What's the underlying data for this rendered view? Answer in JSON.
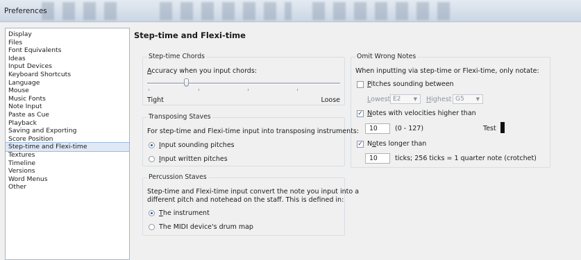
{
  "window": {
    "title": "Preferences"
  },
  "sidebar": {
    "items": [
      "Display",
      "Files",
      "Font Equivalents",
      "Ideas",
      "Input Devices",
      "Keyboard Shortcuts",
      "Language",
      "Mouse",
      "Music Fonts",
      "Note Input",
      "Paste as Cue",
      "Playback",
      "Saving and Exporting",
      "Score Position",
      "Step-time and Flexi-time",
      "Textures",
      "Timeline",
      "Versions",
      "Word Menus",
      "Other"
    ],
    "selected": "Step-time and Flexi-time"
  },
  "page": {
    "title": "Step-time and Flexi-time"
  },
  "chords": {
    "legend": "Step-time Chords",
    "accuracy_label": "Accuracy when you input chords:",
    "accuracy_level": 0.25,
    "min_label": "Tight",
    "max_label": "Loose"
  },
  "transposing": {
    "legend": "Transposing Staves",
    "description": "For step-time and Flexi-time input into transposing instruments:",
    "options": [
      "Input sounding pitches",
      "Input written pitches"
    ],
    "selected": 0
  },
  "percussion": {
    "legend": "Percussion Staves",
    "description_line1": "Step-time and Flexi-time input convert the note you input into a",
    "description_line2": "different pitch and notehead on the staff. This is defined in:",
    "options": [
      "The instrument",
      "The MIDI device's drum map"
    ],
    "selected": 0
  },
  "omit": {
    "legend": "Omit Wrong Notes",
    "description": "When inputting via step-time or Flexi-time, only notate:",
    "pitches_label": "Pitches sounding between",
    "pitches_checked": false,
    "lowest_label": "Lowest",
    "lowest_value": "E2",
    "highest_label": "Highest",
    "highest_value": "G5",
    "velocity_label": "Notes with velocities higher than",
    "velocity_checked": true,
    "velocity_value": "10",
    "velocity_range": "(0 - 127)",
    "test_label": "Test",
    "longer_label": "Notes longer than",
    "longer_checked": true,
    "longer_value": "10",
    "ticks_note": "ticks; 256 ticks = 1 quarter note (crotchet)"
  },
  "colors": {
    "selection": "#dfe8f5",
    "accent": "#2458a8",
    "titlebar": "#cad6e4"
  }
}
